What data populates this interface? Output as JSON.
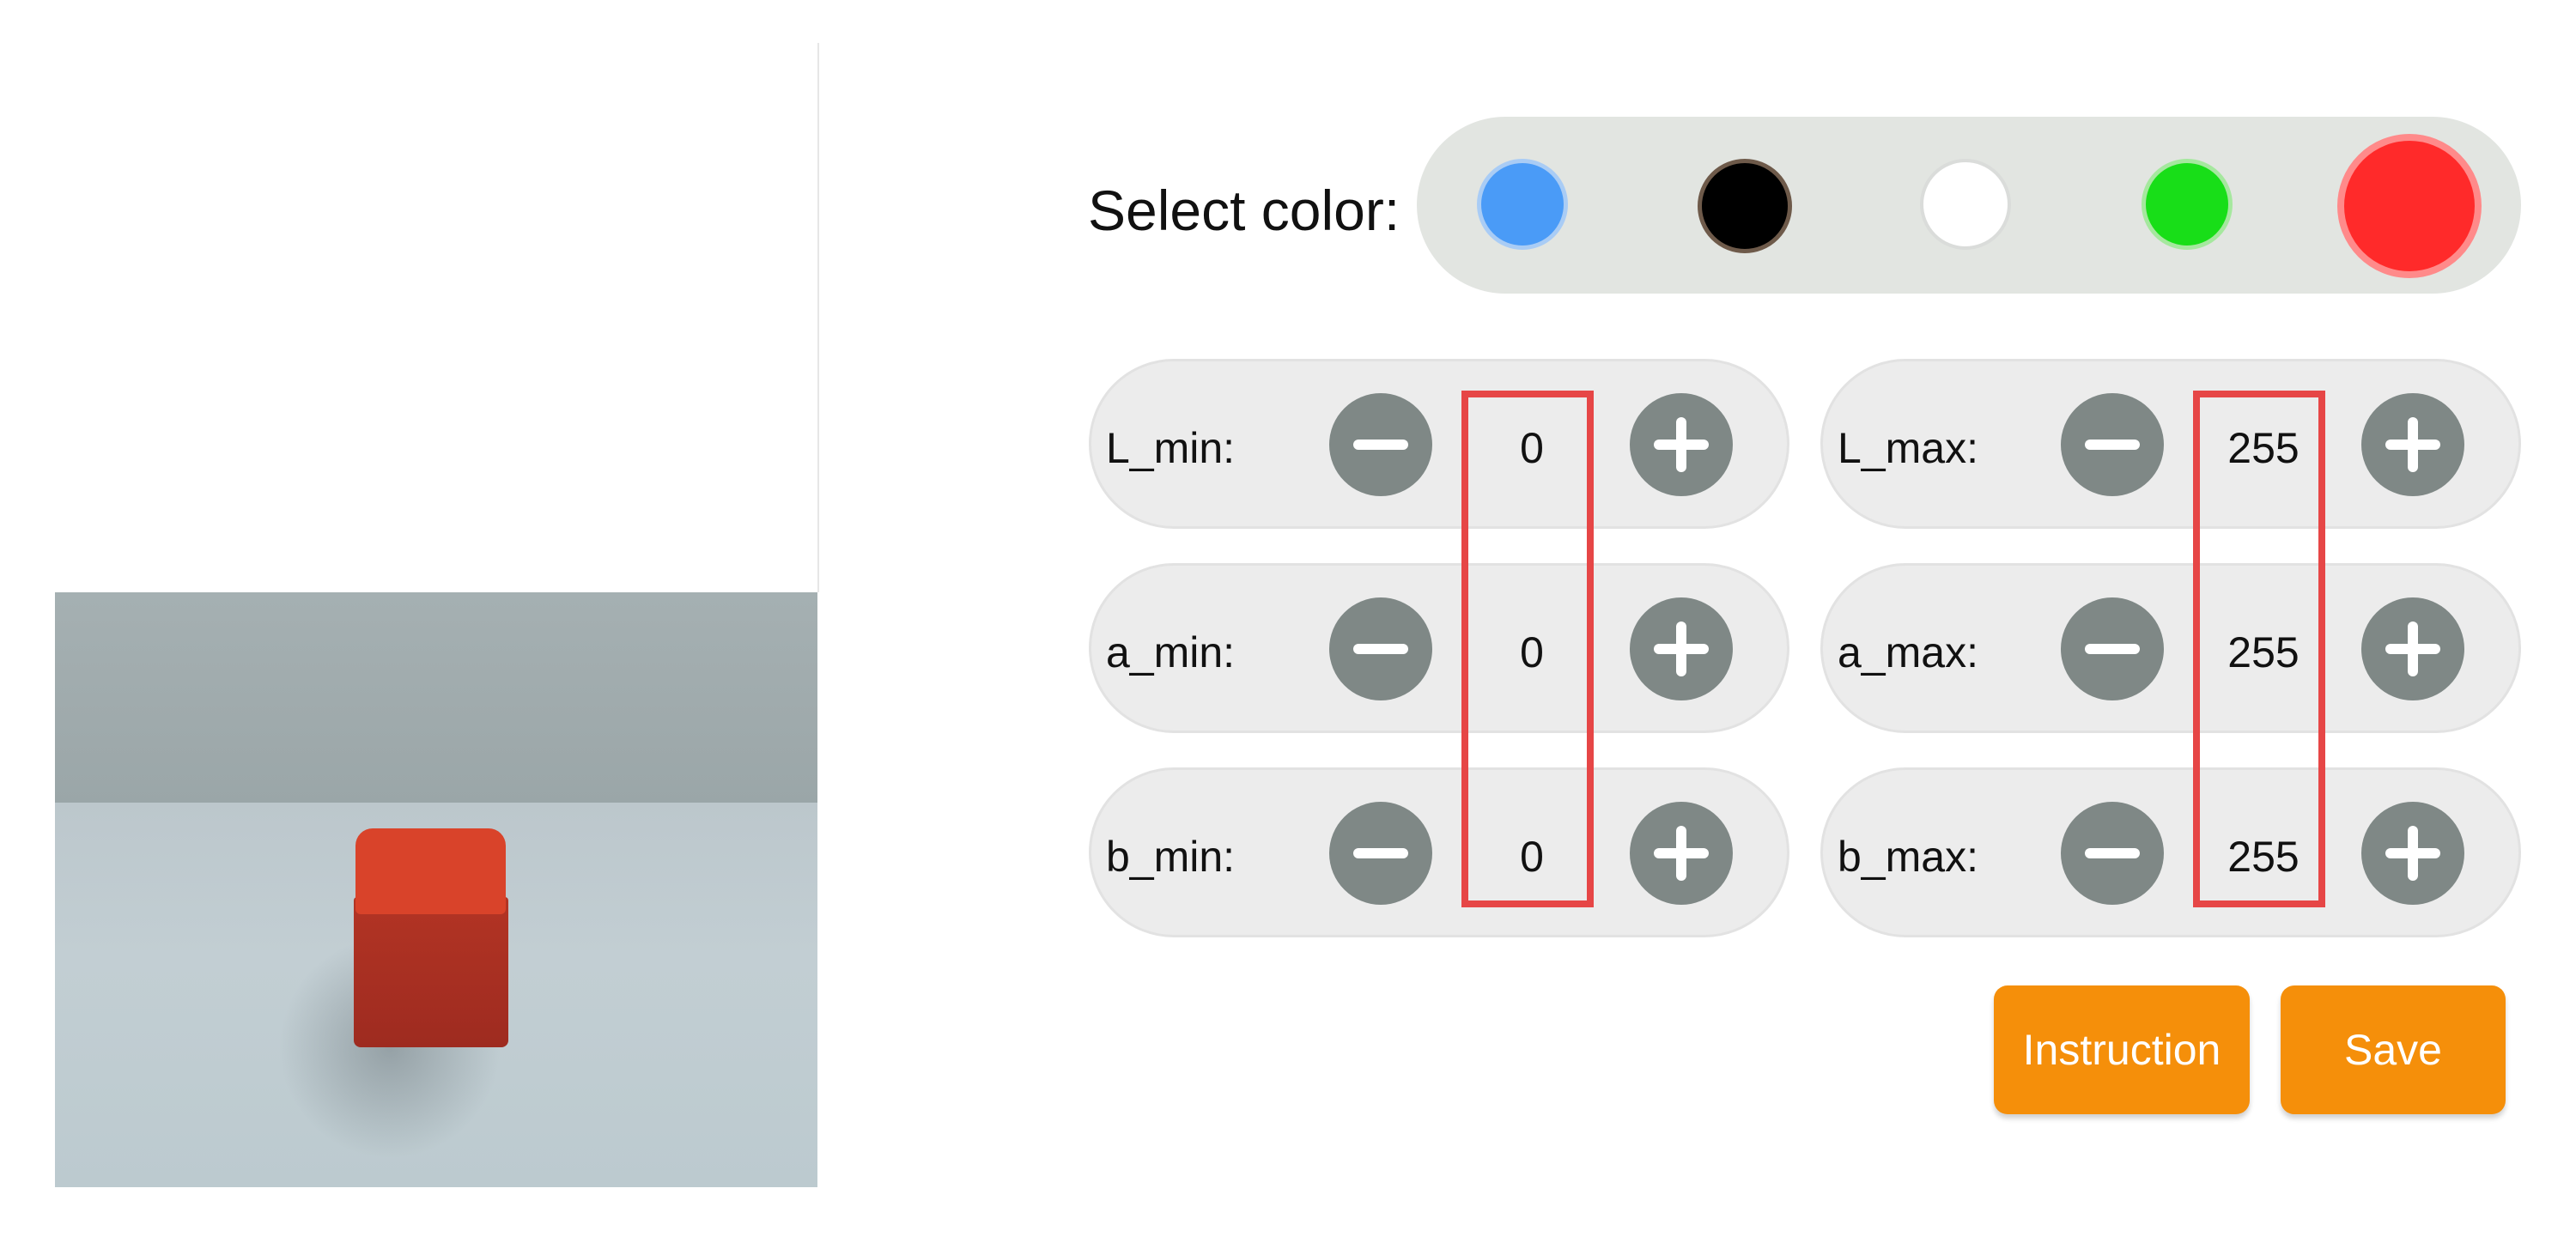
{
  "color_selector": {
    "label": "Select color:",
    "swatches": [
      {
        "name": "blue",
        "color": "#4a9bf7"
      },
      {
        "name": "black",
        "color": "#000000"
      },
      {
        "name": "white",
        "color": "#ffffff"
      },
      {
        "name": "green",
        "color": "#18de18"
      },
      {
        "name": "red",
        "color": "#ff2a2a"
      }
    ],
    "selected": "red"
  },
  "thresholds": {
    "l_min": {
      "label": "L_min:",
      "value": "0"
    },
    "a_min": {
      "label": "a_min:",
      "value": "0"
    },
    "b_min": {
      "label": "b_min:",
      "value": "0"
    },
    "l_max": {
      "label": "L_max:",
      "value": "255"
    },
    "a_max": {
      "label": "a_max:",
      "value": "255"
    },
    "b_max": {
      "label": "b_max:",
      "value": "255"
    }
  },
  "icons": {
    "decrement": "minus-icon",
    "increment": "plus-icon"
  },
  "highlight_color": "#e64646",
  "accent_color": "#f58f0a",
  "actions": {
    "instruction_label": "Instruction",
    "save_label": "Save"
  }
}
